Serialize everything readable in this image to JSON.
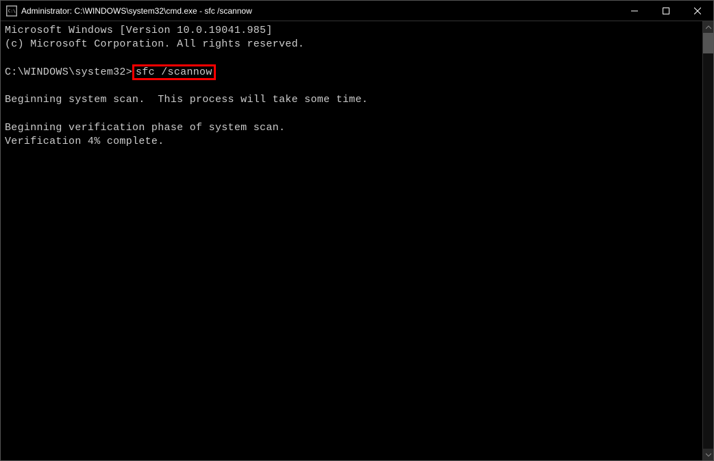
{
  "titlebar": {
    "icon_label": "cmd",
    "title": "Administrator: C:\\WINDOWS\\system32\\cmd.exe - sfc  /scannow"
  },
  "terminal": {
    "line1": "Microsoft Windows [Version 10.0.19041.985]",
    "line2": "(c) Microsoft Corporation. All rights reserved.",
    "prompt": "C:\\WINDOWS\\system32>",
    "command": "sfc /scannow",
    "line_scan": "Beginning system scan.  This process will take some time.",
    "line_phase": "Beginning verification phase of system scan.",
    "line_progress": "Verification 4% complete."
  }
}
